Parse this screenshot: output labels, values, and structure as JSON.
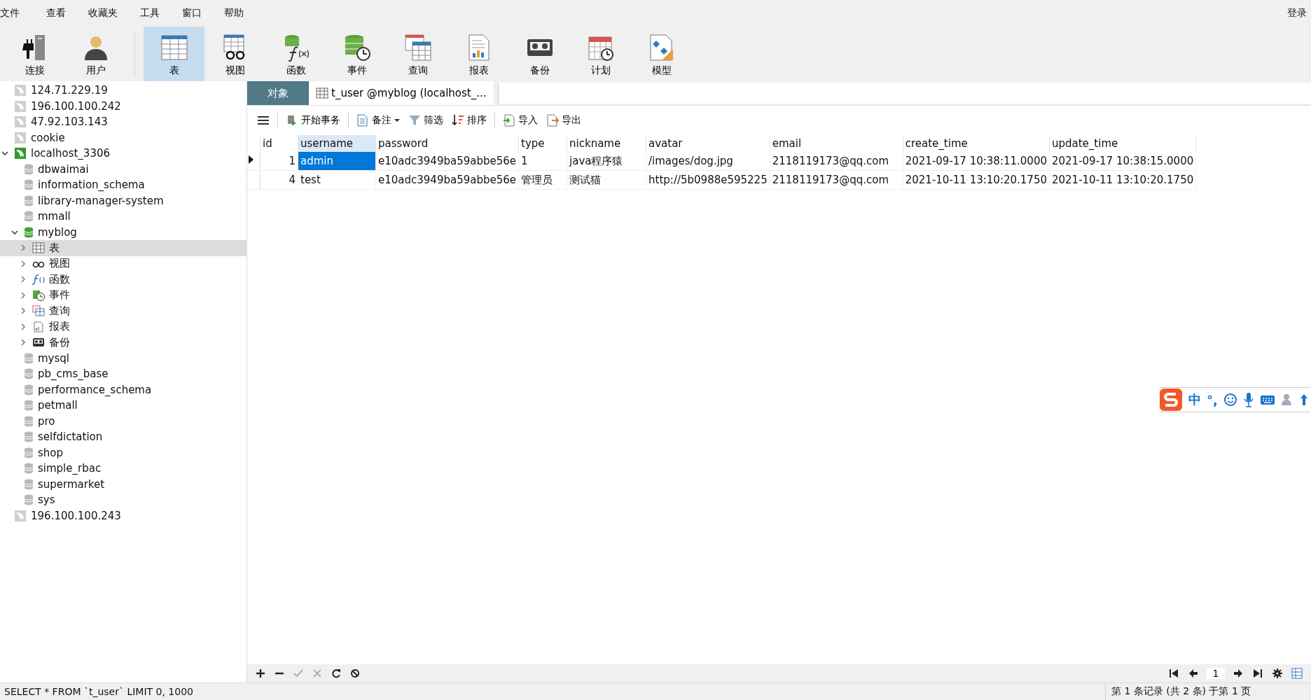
{
  "menu": [
    "文件",
    "查看",
    "收藏夹",
    "工具",
    "窗口",
    "帮助"
  ],
  "login": "登录",
  "toolbar": [
    {
      "label": "连接",
      "kind": "connect",
      "selected": false
    },
    {
      "label": "用户",
      "kind": "user",
      "selected": false
    },
    {
      "label": "表",
      "kind": "table",
      "selected": true
    },
    {
      "label": "视图",
      "kind": "view",
      "selected": false
    },
    {
      "label": "函数",
      "kind": "function",
      "selected": false
    },
    {
      "label": "事件",
      "kind": "event",
      "selected": false
    },
    {
      "label": "查询",
      "kind": "query",
      "selected": false
    },
    {
      "label": "报表",
      "kind": "report",
      "selected": false
    },
    {
      "label": "备份",
      "kind": "backup",
      "selected": false
    },
    {
      "label": "计划",
      "kind": "schedule",
      "selected": false
    },
    {
      "label": "模型",
      "kind": "model",
      "selected": false
    }
  ],
  "tree": [
    {
      "label": "124.71.229.19",
      "kind": "connection",
      "open": false
    },
    {
      "label": "196.100.100.242",
      "kind": "connection",
      "open": false
    },
    {
      "label": "47.92.103.143",
      "kind": "connection",
      "open": false
    },
    {
      "label": "cookie",
      "kind": "connection",
      "open": false
    },
    {
      "label": "localhost_3306",
      "kind": "connection",
      "open": true,
      "expanded": true,
      "children": [
        {
          "label": "dbwaimai",
          "kind": "database",
          "open": false
        },
        {
          "label": "information_schema",
          "kind": "database",
          "open": false
        },
        {
          "label": "library-manager-system",
          "kind": "database",
          "open": false
        },
        {
          "label": "mmall",
          "kind": "database",
          "open": false
        },
        {
          "label": "myblog",
          "kind": "database",
          "open": true,
          "expanded": true,
          "children": [
            {
              "label": "表",
              "kind": "table",
              "expanded": false,
              "selected": true
            },
            {
              "label": "视图",
              "kind": "view",
              "expanded": false,
              "selected": false
            },
            {
              "label": "函数",
              "kind": "function",
              "expanded": false,
              "selected": false
            },
            {
              "label": "事件",
              "kind": "event",
              "expanded": false,
              "selected": false
            },
            {
              "label": "查询",
              "kind": "query",
              "expanded": false,
              "selected": false
            },
            {
              "label": "报表",
              "kind": "report",
              "expanded": false,
              "selected": false
            },
            {
              "label": "备份",
              "kind": "backup",
              "expanded": false,
              "selected": false
            }
          ]
        },
        {
          "label": "mysql",
          "kind": "database",
          "open": false
        },
        {
          "label": "pb_cms_base",
          "kind": "database",
          "open": false
        },
        {
          "label": "performance_schema",
          "kind": "database",
          "open": false
        },
        {
          "label": "petmall",
          "kind": "database",
          "open": false
        },
        {
          "label": "pro",
          "kind": "database",
          "open": false
        },
        {
          "label": "selfdictation",
          "kind": "database",
          "open": false
        },
        {
          "label": "shop",
          "kind": "database",
          "open": false
        },
        {
          "label": "simple_rbac",
          "kind": "database",
          "open": false
        },
        {
          "label": "supermarket",
          "kind": "database",
          "open": false
        },
        {
          "label": "sys",
          "kind": "database",
          "open": false
        }
      ]
    },
    {
      "label": "196.100.100.243",
      "kind": "connection",
      "open": false
    }
  ],
  "tabs": [
    {
      "label": "对象",
      "kind": "objects",
      "selected": false
    },
    {
      "label": "t_user @myblog (localhost_...",
      "kind": "table",
      "selected": true
    }
  ],
  "table_toolbar": [
    {
      "label": "开始事务",
      "kind": "transaction",
      "dropdown": false
    },
    {
      "label": "备注",
      "kind": "memo",
      "dropdown": true
    },
    {
      "label": "筛选",
      "kind": "filter",
      "dropdown": false
    },
    {
      "label": "排序",
      "kind": "sort",
      "dropdown": false
    },
    {
      "label": "导入",
      "kind": "import",
      "dropdown": false
    },
    {
      "label": "导出",
      "kind": "export",
      "dropdown": false
    }
  ],
  "table": {
    "columns": [
      {
        "label": "id"
      },
      {
        "label": "username"
      },
      {
        "label": "password"
      },
      {
        "label": "type"
      },
      {
        "label": "nickname"
      },
      {
        "label": "avatar"
      },
      {
        "label": "email"
      },
      {
        "label": "create_time"
      },
      {
        "label": "update_time"
      }
    ],
    "rows": [
      {
        "current": true,
        "cells": [
          {
            "text": "1",
            "selected": false
          },
          {
            "text": "admin",
            "selected": true
          },
          {
            "text": "e10adc3949ba59abbe56e",
            "selected": false
          },
          {
            "text": "1",
            "selected": false
          },
          {
            "text": "java程序猿",
            "selected": false
          },
          {
            "text": "/images/dog.jpg",
            "selected": false
          },
          {
            "text": "2118119173@qq.com",
            "selected": false
          },
          {
            "text": "2021-09-17 10:38:11.0000",
            "selected": false
          },
          {
            "text": "2021-09-17 10:38:15.0000",
            "selected": false
          }
        ]
      },
      {
        "current": false,
        "cells": [
          {
            "text": "4",
            "selected": false
          },
          {
            "text": "test",
            "selected": false
          },
          {
            "text": "e10adc3949ba59abbe56e",
            "selected": false
          },
          {
            "text": "管理员",
            "selected": false
          },
          {
            "text": "测试猫",
            "selected": false
          },
          {
            "text": "http://5b0988e595225",
            "selected": false
          },
          {
            "text": "2118119173@qq.com",
            "selected": false
          },
          {
            "text": "2021-10-11 13:10:20.1750",
            "selected": false
          },
          {
            "text": "2021-10-11 13:10:20.1750",
            "selected": false
          }
        ]
      }
    ]
  },
  "record_actions": [
    {
      "kind": "add",
      "disabled": false
    },
    {
      "kind": "delete",
      "disabled": false
    },
    {
      "kind": "apply",
      "disabled": true
    },
    {
      "kind": "cancel",
      "disabled": true
    },
    {
      "kind": "refresh",
      "disabled": false
    },
    {
      "kind": "stop",
      "disabled": false
    }
  ],
  "pager": {
    "page": "1"
  },
  "status_bar": {
    "sql": "SELECT * FROM `t_user` LIMIT 0, 1000",
    "records": "第 1 条记录 (共 2 条) 于第 1 页"
  },
  "ime_bar": {
    "mode": "中",
    "punct": "°,"
  }
}
